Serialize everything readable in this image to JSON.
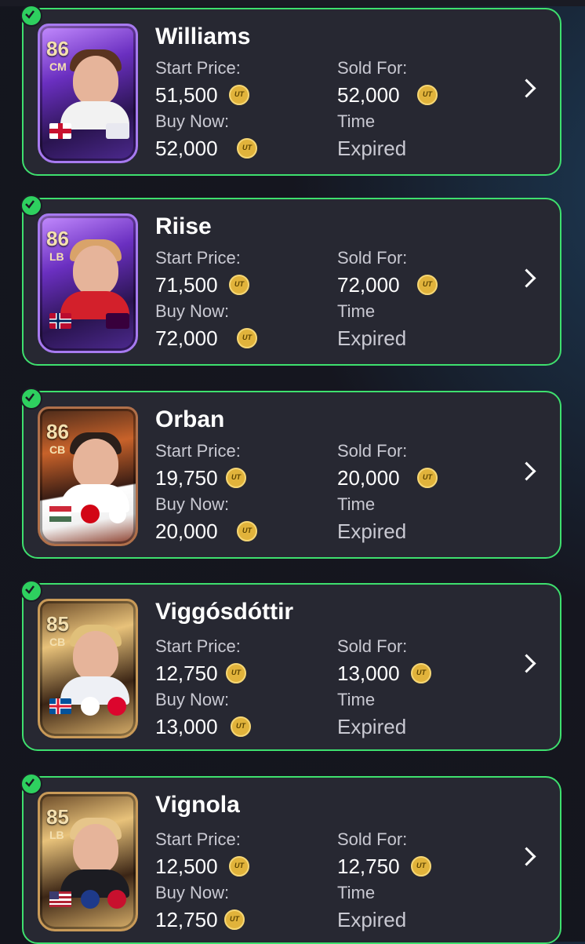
{
  "labels": {
    "start_price": "Start Price:",
    "buy_now": "Buy Now:",
    "sold_for": "Sold For:",
    "time": "Time",
    "expired": "Expired"
  },
  "items": [
    {
      "name": "Williams",
      "rating": "86",
      "position": "CM",
      "start_price": "51,500",
      "buy_now": "52,000",
      "sold_for": "52,000",
      "card_style": "purple"
    },
    {
      "name": "Riise",
      "rating": "86",
      "position": "LB",
      "start_price": "71,500",
      "buy_now": "72,000",
      "sold_for": "72,000",
      "card_style": "purple"
    },
    {
      "name": "Orban",
      "rating": "86",
      "position": "CB",
      "start_price": "19,750",
      "buy_now": "20,000",
      "sold_for": "20,000",
      "card_style": "flame"
    },
    {
      "name": "Viggósdóttir",
      "rating": "85",
      "position": "CB",
      "start_price": "12,750",
      "buy_now": "13,000",
      "sold_for": "13,000",
      "card_style": "gold"
    },
    {
      "name": "Vignola",
      "rating": "85",
      "position": "LB",
      "start_price": "12,500",
      "buy_now": "12,750",
      "sold_for": "12,750",
      "card_style": "gold"
    }
  ],
  "colors": {
    "card_bg": "#272832",
    "card_border": "#3ee06e",
    "check": "#2ed05f",
    "coin": "#e1b33b"
  },
  "icons": {
    "check": "check-circle-icon",
    "coin": "ut-coin-icon",
    "arrow": "chevron-right-icon"
  }
}
